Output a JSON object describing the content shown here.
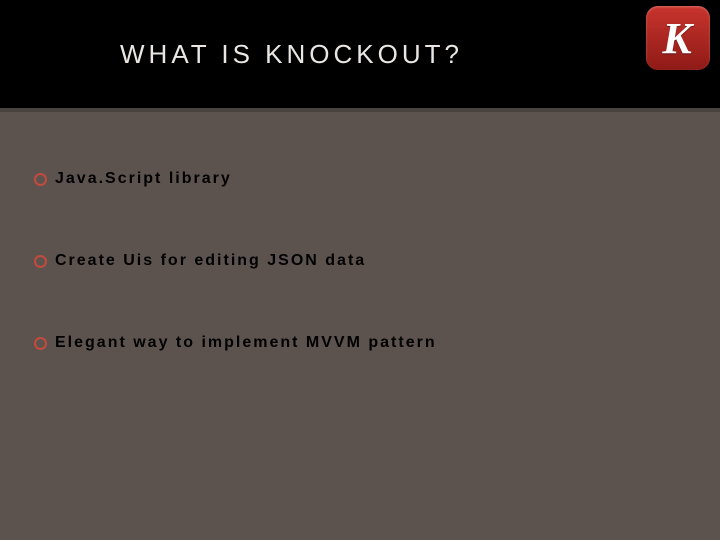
{
  "title": "WHAT IS KNOCKOUT?",
  "logo": {
    "letter": "K"
  },
  "bullets": [
    {
      "text": "Java.Script library"
    },
    {
      "text": "Create Uis for editing JSON data"
    },
    {
      "text": "Elegant way to implement MVVM pattern"
    }
  ],
  "colors": {
    "background": "#5d534e",
    "titleBand": "#000000",
    "titleText": "#e9e6e4",
    "bulletRing": "#c24a3e",
    "logoTop": "#c8342d",
    "logoBottom": "#8f1a16"
  }
}
